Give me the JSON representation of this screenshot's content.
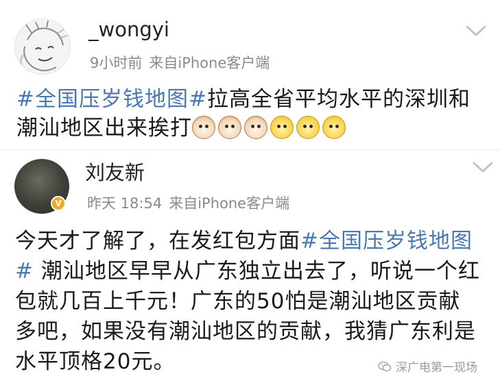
{
  "posts": [
    {
      "username": "_wongyi",
      "time": "9小时前",
      "source": "来自iPhone客户端",
      "content": {
        "hashtag": "#全国压岁钱地图#",
        "text": "拉高全省平均水平的深圳和潮汕地区出来挨打",
        "emojis": [
          "cat-emoji",
          "cat-emoji",
          "cat-emoji",
          "dog-emoji",
          "dog-emoji",
          "dog-emoji"
        ]
      }
    },
    {
      "username": "刘友新",
      "verified_badge": "V",
      "time": "昨天 18:54",
      "source": "来自iPhone客户端",
      "content": {
        "text_before": "今天才了解了，在发红包方面",
        "hashtag": "#全国压岁钱地图#",
        "text_after": " 潮汕地区早早从广东独立出去了，听说一个红包就几百上千元！广东的50怕是潮汕地区贡献多吧，如果没有潮汕地区的贡献，我猜广东利是水平顶格20元。"
      }
    }
  ],
  "watermark": {
    "text": "深广电第一现场",
    "icon": "wechat-icon"
  }
}
